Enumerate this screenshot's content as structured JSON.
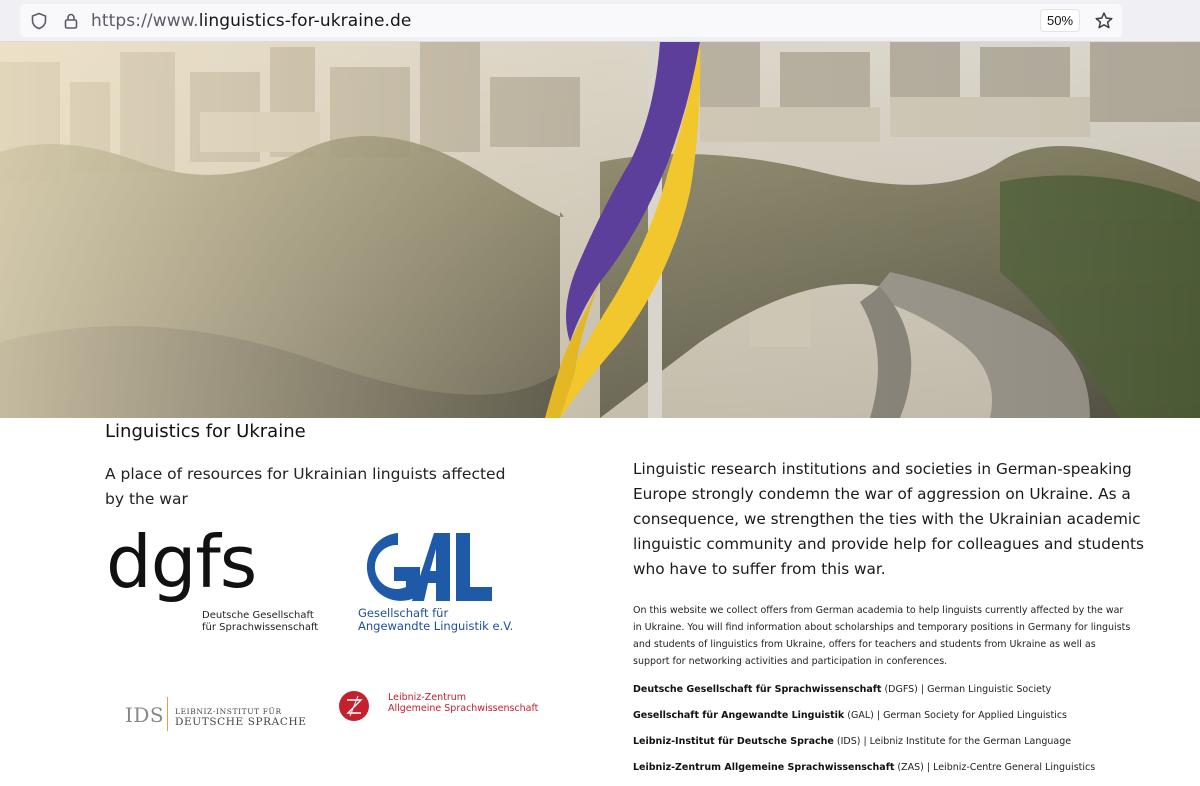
{
  "browser": {
    "url_prefix": "https://www.",
    "url_domain": "linguistics-for-ukraine.de",
    "zoom": "50%"
  },
  "content": {
    "title": "Linguistics for Ukraine",
    "tagline": "A place of resources for Ukrainian linguists affected by the war",
    "statement": "Linguistic research institutions and societies in German-speaking Europe strongly condemn the war of aggression on Ukraine. As a consequence, we strengthen the ties with the Ukrainian academic linguistic community and provide help for colleagues and students who have to suffer from this war.",
    "info": "On this website we collect offers from German academia to help linguists currently affected by the war in Ukraine. You will find information about scholarships and temporary positions in Germany for linguists and students of linguistics from Ukraine, offers for teachers and students from Ukraine as well as support for networking activities and participation in conferences."
  },
  "logos": {
    "dgfs_mark": "dgfs",
    "dgfs_line1": "Deutsche Gesellschaft",
    "dgfs_line2": "für Sprachwissenschaft",
    "gal_line1": "Gesellschaft für",
    "gal_line2": "Angewandte Linguistik e.V.",
    "ids_mark": "IDS",
    "ids_line1": "LEIBNIZ-INSTITUT FÜR",
    "ids_line2": "DEUTSCHE SPRACHE",
    "zas_line1": "Leibniz-Zentrum",
    "zas_line2": "Allgemeine Sprachwissenschaft"
  },
  "organizations": [
    {
      "name": "Deutsche Gesellschaft für Sprachwissenschaft",
      "rest": " (DGFS) | German Linguistic Society"
    },
    {
      "name": "Gesellschaft für Angewandte Linguistik",
      "rest": " (GAL) | German Society for Applied Linguistics"
    },
    {
      "name": "Leibniz-Institut für Deutsche Sprache",
      "rest": " (IDS) | Leibniz Institute for the German Language"
    },
    {
      "name": "Leibniz-Zentrum Allgemeine Sprachwissenschaft",
      "rest": " (ZAS) | Leibniz-Centre General Linguistics"
    }
  ],
  "colors": {
    "flag_blue": "#5b3f9a",
    "flag_yellow": "#f2c72e",
    "gal_blue": "#1e5aa8",
    "zas_red": "#c4202e",
    "ids_gold": "#d9a441"
  },
  "icons": {
    "shield": "shield-icon",
    "lock": "lock-icon",
    "star": "bookmark-star-icon"
  }
}
